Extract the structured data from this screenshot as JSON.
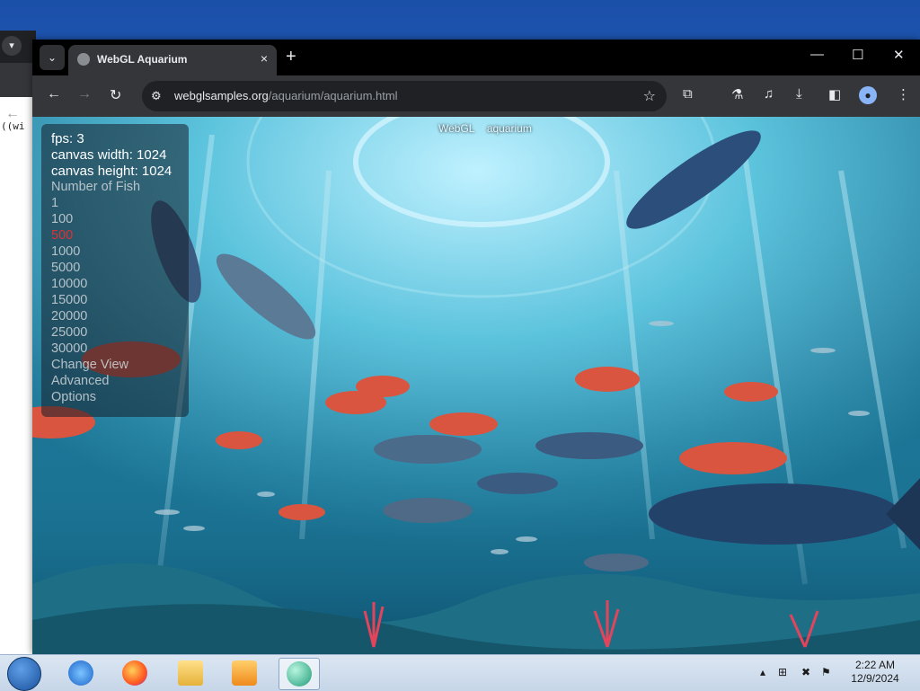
{
  "background_window": {
    "code_snippet": "((wi"
  },
  "browser": {
    "tab": {
      "title": "WebGL Aquarium",
      "close": "×"
    },
    "new_tab": "+",
    "window_controls": {
      "minimize": "—",
      "maximize": "☐",
      "close": "✕"
    },
    "nav": {
      "back": "←",
      "forward": "→",
      "reload": "↻"
    },
    "omnibox": {
      "domain": "webglsamples.org",
      "path": "/aquarium/aquarium.html"
    }
  },
  "page": {
    "top_links": [
      "WebGL",
      "aquarium"
    ],
    "stats": {
      "fps": "fps: 3",
      "canvas_width": "canvas width: 1024",
      "canvas_height": "canvas height: 1024"
    },
    "number_of_fish_label": "Number of Fish",
    "fish_options": [
      "1",
      "100",
      "500",
      "1000",
      "5000",
      "10000",
      "15000",
      "20000",
      "25000",
      "30000"
    ],
    "selected_fish_option": "500",
    "links": [
      "Change View",
      "Advanced",
      "Options"
    ]
  },
  "taskbar": {
    "apps": [
      "internet-explorer",
      "firefox",
      "file-explorer",
      "media-player",
      "chrome-app"
    ],
    "clock_time": "2:22 AM",
    "clock_date": "12/9/2024"
  },
  "colors": {
    "water": "#2c8fb0",
    "selected_option": "#ff2a2a",
    "chrome_dark": "#202124"
  }
}
